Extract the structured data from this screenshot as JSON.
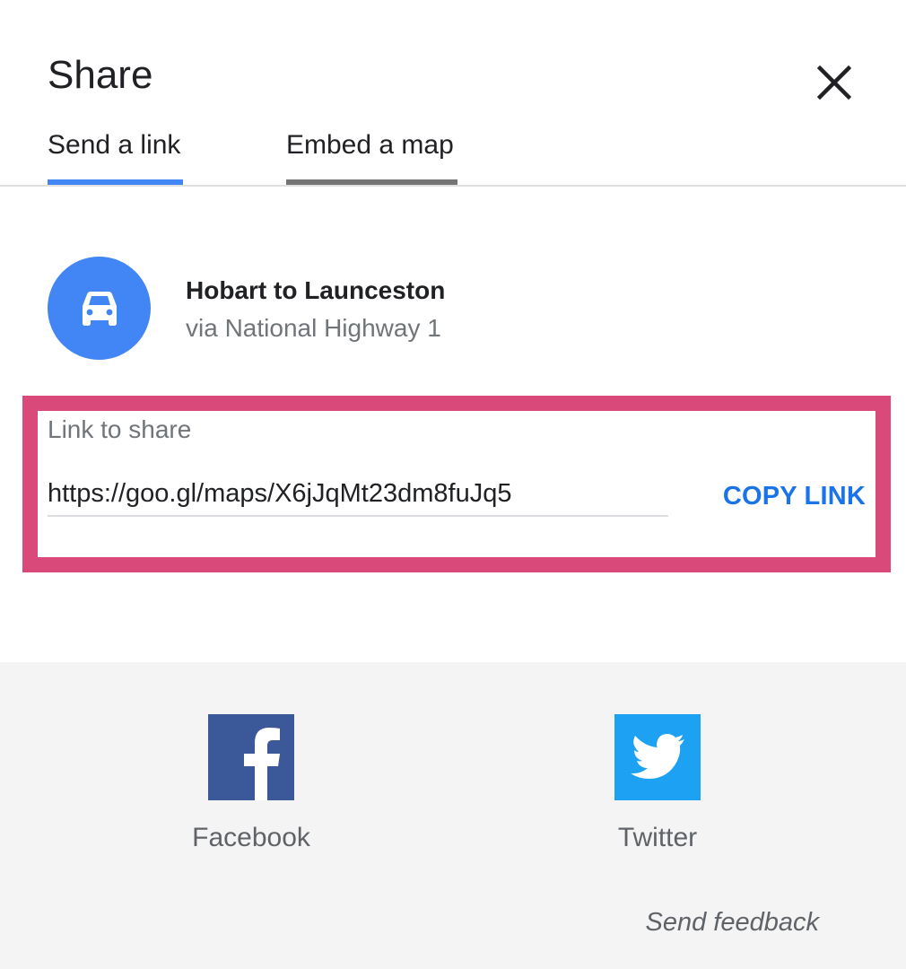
{
  "dialog": {
    "title": "Share",
    "close_icon": "close-icon"
  },
  "tabs": [
    {
      "label": "Send a link",
      "active": true,
      "underline_color": "#4285f4"
    },
    {
      "label": "Embed a map",
      "active": false,
      "underline_color": "#757575"
    }
  ],
  "route": {
    "icon": "car-icon",
    "title": "Hobart to Launceston",
    "subtitle": "via National Highway 1",
    "avatar_color": "#4285f4"
  },
  "link": {
    "label": "Link to share",
    "value": "https://goo.gl/maps/X6jJqMt23dm8fuJq5",
    "copy_label": "COPY LINK",
    "highlight_color": "#d9497a"
  },
  "social": [
    {
      "label": "Facebook",
      "icon": "facebook-icon",
      "color": "#3b5998"
    },
    {
      "label": "Twitter",
      "icon": "twitter-icon",
      "color": "#1da1f2"
    }
  ],
  "feedback": {
    "label": "Send feedback"
  }
}
